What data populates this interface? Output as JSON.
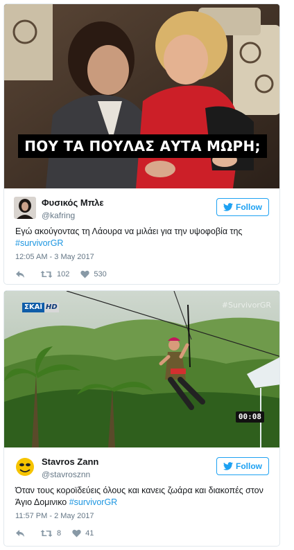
{
  "tweets": [
    {
      "media": {
        "caption": "ΠΟΥ ΤΑ ΠΟΥΛΑΣ ΑΥΤΑ ΜΩΡΗ;"
      },
      "author": {
        "name": "Φυσικός Μπλε",
        "handle": "@kafring"
      },
      "follow_label": "Follow",
      "text": "Εγώ ακούγοντας τη Λάουρα να μιλάει για την υψοφοβία της",
      "hashtag": "#survivorGR",
      "time": "12:05 AM",
      "date_sep": " - ",
      "date": "3 May 2017",
      "retweets": "102",
      "likes": "530"
    },
    {
      "media": {
        "channel_logo": "ΣΚΑΪ",
        "channel_hd": "HD",
        "watermark": "#SurvivorGR",
        "timer": "00:08"
      },
      "author": {
        "name": "Stavros Zann",
        "handle": "@stavrosznn"
      },
      "follow_label": "Follow",
      "text": "Όταν τους κοροϊδεύεις όλους και κανεις ζωάρα και διακοπές στον Άγιο Δομινικο",
      "hashtag": "#survivorGR",
      "time": "11:57 PM",
      "date_sep": " - ",
      "date": "2 May 2017",
      "retweets": "8",
      "likes": "41"
    }
  ],
  "colors": {
    "link": "#1b95e0",
    "follow": "#1da1f2",
    "muted": "#657786",
    "border": "#e1e8ed"
  },
  "icons": [
    "reply-icon",
    "retweet-icon",
    "like-icon",
    "twitter-bird-icon"
  ]
}
